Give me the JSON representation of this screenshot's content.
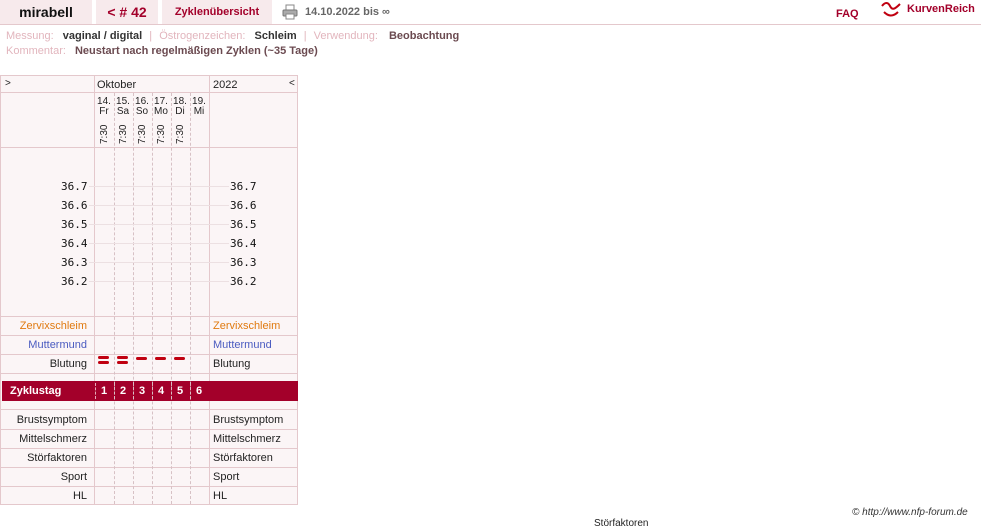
{
  "header": {
    "user": "mirabell",
    "cycle": "< # 42",
    "overview_tab": "Zyklenübersicht",
    "date_range": "14.10.2022 bis ∞",
    "faq": "FAQ",
    "logo_text": "KurvenReich",
    "icons": [
      "printer-icon",
      "kurvenreich-logo-icon"
    ]
  },
  "meta": {
    "messung_label": "Messung:",
    "messung_value": "vaginal / digital",
    "oestrogen_label": "Östrogenzeichen:",
    "oestrogen_value": "Schleim",
    "verwendung_label": "Verwendung:",
    "verwendung_value": "Beobachtung",
    "kommentar_label": "Kommentar:",
    "kommentar_value": "Neustart nach regelmäßigen Zyklen (~35 Tage)",
    "separator": "|"
  },
  "chart": {
    "nav_next": ">",
    "nav_prev": "<",
    "month": "Oktober",
    "year": "2022",
    "days": [
      {
        "date": "14.",
        "weekday": "Fr",
        "time": "7:30",
        "cycle_day": "1",
        "bleeding": 2
      },
      {
        "date": "15.",
        "weekday": "Sa",
        "time": "7:30",
        "cycle_day": "2",
        "bleeding": 2
      },
      {
        "date": "16.",
        "weekday": "So",
        "time": "7:30",
        "cycle_day": "3",
        "bleeding": 1
      },
      {
        "date": "17.",
        "weekday": "Mo",
        "time": "7:30",
        "cycle_day": "4",
        "bleeding": 1
      },
      {
        "date": "18.",
        "weekday": "Di",
        "time": "7:30",
        "cycle_day": "5",
        "bleeding": 1
      },
      {
        "date": "19.",
        "weekday": "Mi",
        "time": "",
        "cycle_day": "6",
        "bleeding": 0
      }
    ],
    "temps": [
      "36.7",
      "36.6",
      "36.5",
      "36.4",
      "36.3",
      "36.2"
    ],
    "rows": {
      "zervix": "Zervixschleim",
      "muttermund": "Muttermund",
      "blutung": "Blutung",
      "zyklustag": "Zyklustag",
      "brust": "Brustsymptom",
      "mittel": "Mittelschmerz",
      "stoer": "Störfaktoren",
      "sport": "Sport",
      "hl": "HL"
    },
    "colors": {
      "zervix": "#e07a10",
      "muttermund": "#4a5bc0",
      "accent": "#a3002a",
      "blood": "#c00010"
    }
  },
  "footer": {
    "copyright": "© http://www.nfp-forum.de",
    "stoer_below": "Störfaktoren"
  }
}
